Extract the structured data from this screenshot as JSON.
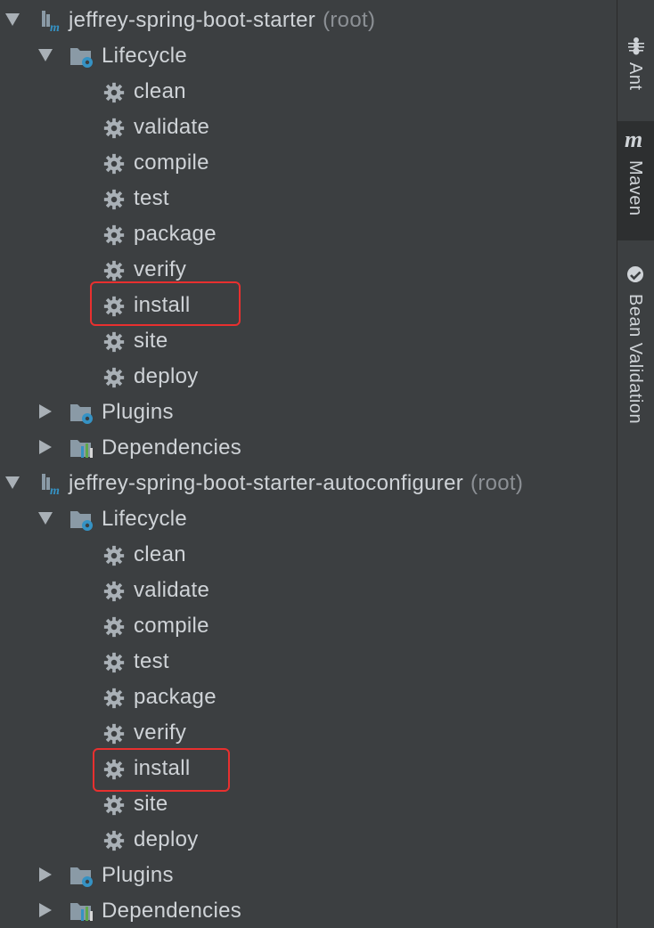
{
  "projects": [
    {
      "name": "jeffrey-spring-boot-starter",
      "suffix": "(root)",
      "lifecycle_label": "Lifecycle",
      "lifecycle": [
        "clean",
        "validate",
        "compile",
        "test",
        "package",
        "verify",
        "install",
        "site",
        "deploy"
      ],
      "plugins_label": "Plugins",
      "dependencies_label": "Dependencies"
    },
    {
      "name": "jeffrey-spring-boot-starter-autoconfigurer",
      "suffix": "(root)",
      "lifecycle_label": "Lifecycle",
      "lifecycle": [
        "clean",
        "validate",
        "compile",
        "test",
        "package",
        "verify",
        "install",
        "site",
        "deploy"
      ],
      "plugins_label": "Plugins",
      "dependencies_label": "Dependencies"
    }
  ],
  "sidebar": {
    "tools": [
      {
        "label": "Ant",
        "icon": "ant-icon"
      },
      {
        "label": "Maven",
        "icon": "maven-icon",
        "active": true
      },
      {
        "label": "Bean Validation",
        "icon": "bean-validation-icon"
      }
    ]
  },
  "colors": {
    "background": "#3c3f41",
    "text": "#cfd3d7",
    "muted": "#8c9095",
    "highlight": "#e8302f",
    "gear": "#a9b0b6",
    "folder": "#8a9aa6",
    "accent_blue": "#3592c4"
  }
}
